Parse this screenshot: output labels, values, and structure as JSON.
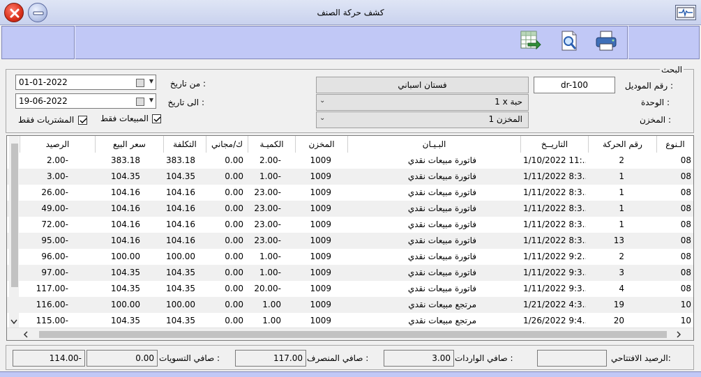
{
  "window": {
    "title": "كشف حركة الصنف"
  },
  "search": {
    "group_title": "البحث",
    "model_label": "رقم الموديل :",
    "model_value": "dr-100",
    "item_name": "فستان اسباني",
    "unit_label": "الوحدة :",
    "unit_value": "1 x حبة",
    "store_label": "المخزن :",
    "store_value": "المخزن 1",
    "from_label": "من تاريخ :",
    "from_value": "01-01-2022",
    "to_label": "الى تاريخ :",
    "to_value": "19-06-2022",
    "sales_only_label": "المبيعات فقط",
    "sales_only_checked": true,
    "purchases_only_label": "المشتريات فقط",
    "purchases_only_checked": true
  },
  "grid": {
    "columns": [
      "الـنوع",
      "رقم الحركة",
      "التاريــخ",
      "البـيـان",
      "المخزن",
      "الكميـة",
      "ك/مجاني",
      "التكلفة",
      "سعر البيع",
      "الرصيد"
    ],
    "rows": [
      [
        "08",
        "2",
        "1/10/2022 11:...",
        "فاتورة مبيعات نقدي",
        "1009",
        "2.00-",
        "0.00",
        "383.18",
        "383.18",
        "2.00-"
      ],
      [
        "08",
        "1",
        "1/11/2022 8:3...",
        "فاتورة مبيعات نقدي",
        "1009",
        "1.00-",
        "0.00",
        "104.35",
        "104.35",
        "3.00-"
      ],
      [
        "08",
        "1",
        "1/11/2022 8:3...",
        "فاتورة مبيعات نقدي",
        "1009",
        "23.00-",
        "0.00",
        "104.16",
        "104.16",
        "26.00-"
      ],
      [
        "08",
        "1",
        "1/11/2022 8:3...",
        "فاتورة مبيعات نقدي",
        "1009",
        "23.00-",
        "0.00",
        "104.16",
        "104.16",
        "49.00-"
      ],
      [
        "08",
        "1",
        "1/11/2022 8:3...",
        "فاتورة مبيعات نقدي",
        "1009",
        "23.00-",
        "0.00",
        "104.16",
        "104.16",
        "72.00-"
      ],
      [
        "08",
        "13",
        "1/11/2022 8:3...",
        "فاتورة مبيعات نقدي",
        "1009",
        "23.00-",
        "0.00",
        "104.16",
        "104.16",
        "95.00-"
      ],
      [
        "08",
        "2",
        "1/11/2022 9:2...",
        "فاتورة مبيعات نقدي",
        "1009",
        "1.00-",
        "0.00",
        "100.00",
        "100.00",
        "96.00-"
      ],
      [
        "08",
        "3",
        "1/11/2022 9:3...",
        "فاتورة مبيعات نقدي",
        "1009",
        "1.00-",
        "0.00",
        "104.35",
        "104.35",
        "97.00-"
      ],
      [
        "08",
        "4",
        "1/11/2022 9:3...",
        "فاتورة مبيعات نقدي",
        "1009",
        "20.00-",
        "0.00",
        "104.35",
        "104.35",
        "117.00-"
      ],
      [
        "10",
        "19",
        "1/21/2022 4:3...",
        "مرتجع مبيعات نقدي",
        "1009",
        "1.00",
        "0.00",
        "100.00",
        "100.00",
        "116.00-"
      ],
      [
        "10",
        "20",
        "1/26/2022 9:4...",
        "مرتجع مبيعات نقدي",
        "1009",
        "1.00",
        "0.00",
        "104.35",
        "104.35",
        "115.00-"
      ]
    ]
  },
  "footer": {
    "opening_label": "الرصيد الافتتاحي:",
    "opening_value": "",
    "incoming_label": "صافي الواردات :",
    "incoming_value": "3.00",
    "outgoing_label": "صافي المنصرف :",
    "outgoing_value": "117.00",
    "adjust_label": "صافي التسويات :",
    "adjust_value": "0.00",
    "balance_value": "114.00-"
  },
  "icons": {
    "close": "close-icon",
    "minimize": "minimize-icon",
    "export": "excel-export-icon",
    "preview": "print-preview-icon",
    "print": "printer-icon",
    "app": "monitor-icon"
  }
}
